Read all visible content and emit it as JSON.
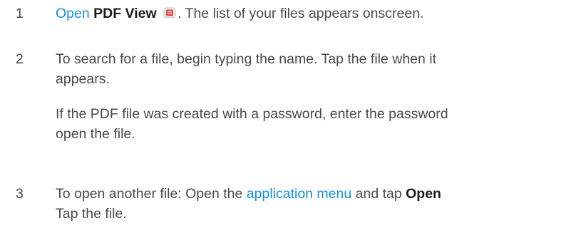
{
  "steps": [
    {
      "number": "1",
      "link_text": "Open",
      "app_name": "PDF View",
      "icon": "pdf-view-app-icon",
      "after_icon": ". The list of your files appears onscreen."
    },
    {
      "number": "2",
      "line1": "To search for a file, begin typing the name. Tap the file when it",
      "line2": "appears.",
      "note_line1": "If the PDF file was created with a password, enter the password",
      "note_line2": "open the file."
    },
    {
      "number": "3",
      "before_link": "To open another file: Open the ",
      "link_text": "application menu",
      "middle": " and tap ",
      "bold_text": "Open",
      "line2": "Tap the file."
    }
  ],
  "colors": {
    "text": "#4a4a4a",
    "link": "#1a8fd4",
    "bold": "#1a1a1a",
    "icon_red": "#d9534f"
  }
}
